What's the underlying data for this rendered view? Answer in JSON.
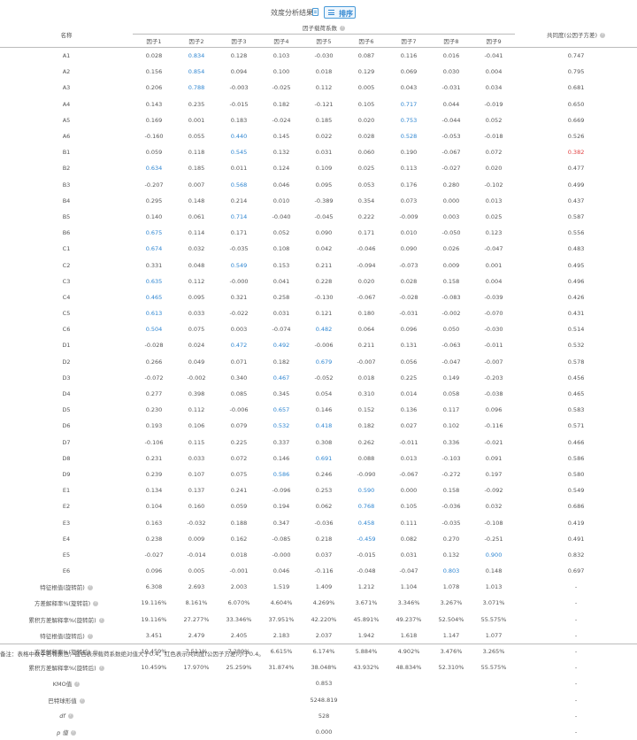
{
  "toolbar": {
    "title": "效度分析结果",
    "sort_label": "排序"
  },
  "table": {
    "name_header": "名称",
    "loading_header": "因子载荷系数",
    "communality_header": "共同度(公因子方差)",
    "factor_headers": [
      "因子1",
      "因子2",
      "因子3",
      "因子4",
      "因子5",
      "因子6",
      "因子7",
      "因子8",
      "因子9"
    ],
    "rows": [
      {
        "name": "A1",
        "vals": [
          "0.028",
          "0.834",
          "0.128",
          "0.103",
          "-0.030",
          "0.087",
          "0.116",
          "0.016",
          "-0.041"
        ],
        "hl": [
          1
        ],
        "comm": "0.747",
        "comm_red": false
      },
      {
        "name": "A2",
        "vals": [
          "0.156",
          "0.854",
          "0.094",
          "0.100",
          "0.018",
          "0.129",
          "0.069",
          "0.030",
          "0.004"
        ],
        "hl": [
          1
        ],
        "comm": "0.795",
        "comm_red": false
      },
      {
        "name": "A3",
        "vals": [
          "0.206",
          "0.788",
          "-0.003",
          "-0.025",
          "0.112",
          "0.005",
          "0.043",
          "-0.031",
          "0.034"
        ],
        "hl": [
          1
        ],
        "comm": "0.681",
        "comm_red": false
      },
      {
        "name": "A4",
        "vals": [
          "0.143",
          "0.235",
          "-0.015",
          "0.182",
          "-0.121",
          "0.105",
          "0.717",
          "0.044",
          "-0.019"
        ],
        "hl": [
          6
        ],
        "comm": "0.650",
        "comm_red": false
      },
      {
        "name": "A5",
        "vals": [
          "0.169",
          "0.001",
          "0.183",
          "-0.024",
          "0.185",
          "0.020",
          "0.753",
          "-0.044",
          "0.052"
        ],
        "hl": [
          6
        ],
        "comm": "0.669",
        "comm_red": false
      },
      {
        "name": "A6",
        "vals": [
          "-0.160",
          "0.055",
          "0.440",
          "0.145",
          "0.022",
          "0.028",
          "0.528",
          "-0.053",
          "-0.018"
        ],
        "hl": [
          2,
          6
        ],
        "comm": "0.526",
        "comm_red": false
      },
      {
        "name": "B1",
        "vals": [
          "0.059",
          "0.118",
          "0.545",
          "0.132",
          "0.031",
          "0.060",
          "0.190",
          "-0.067",
          "0.072"
        ],
        "hl": [
          2
        ],
        "comm": "0.382",
        "comm_red": true
      },
      {
        "name": "B2",
        "vals": [
          "0.634",
          "0.185",
          "0.011",
          "0.124",
          "0.109",
          "0.025",
          "0.113",
          "-0.027",
          "0.020"
        ],
        "hl": [
          0
        ],
        "comm": "0.477",
        "comm_red": false
      },
      {
        "name": "B3",
        "vals": [
          "-0.207",
          "0.007",
          "0.568",
          "0.046",
          "0.095",
          "0.053",
          "0.176",
          "0.280",
          "-0.102"
        ],
        "hl": [
          2
        ],
        "comm": "0.499",
        "comm_red": false
      },
      {
        "name": "B4",
        "vals": [
          "0.295",
          "0.148",
          "0.214",
          "0.010",
          "-0.389",
          "0.354",
          "0.073",
          "0.000",
          "0.013"
        ],
        "hl": [],
        "comm": "0.437",
        "comm_red": false
      },
      {
        "name": "B5",
        "vals": [
          "0.140",
          "0.061",
          "0.714",
          "-0.040",
          "-0.045",
          "0.222",
          "-0.009",
          "0.003",
          "0.025"
        ],
        "hl": [
          2
        ],
        "comm": "0.587",
        "comm_red": false
      },
      {
        "name": "B6",
        "vals": [
          "0.675",
          "0.114",
          "0.171",
          "0.052",
          "0.090",
          "0.171",
          "0.010",
          "-0.050",
          "0.123"
        ],
        "hl": [
          0
        ],
        "comm": "0.556",
        "comm_red": false
      },
      {
        "name": "C1",
        "vals": [
          "0.674",
          "0.032",
          "-0.035",
          "0.108",
          "0.042",
          "-0.046",
          "0.090",
          "0.026",
          "-0.047"
        ],
        "hl": [
          0
        ],
        "comm": "0.483",
        "comm_red": false
      },
      {
        "name": "C2",
        "vals": [
          "0.331",
          "0.048",
          "0.549",
          "0.153",
          "0.211",
          "-0.094",
          "-0.073",
          "0.009",
          "0.001"
        ],
        "hl": [
          2
        ],
        "comm": "0.495",
        "comm_red": false
      },
      {
        "name": "C3",
        "vals": [
          "0.635",
          "0.112",
          "-0.000",
          "0.041",
          "0.228",
          "0.020",
          "0.028",
          "0.158",
          "0.004"
        ],
        "hl": [
          0
        ],
        "comm": "0.496",
        "comm_red": false
      },
      {
        "name": "C4",
        "vals": [
          "0.465",
          "0.095",
          "0.321",
          "0.258",
          "-0.130",
          "-0.067",
          "-0.028",
          "-0.083",
          "-0.039"
        ],
        "hl": [
          0
        ],
        "comm": "0.426",
        "comm_red": false
      },
      {
        "name": "C5",
        "vals": [
          "0.613",
          "0.033",
          "-0.022",
          "0.031",
          "0.121",
          "0.180",
          "-0.031",
          "-0.002",
          "-0.070"
        ],
        "hl": [
          0
        ],
        "comm": "0.431",
        "comm_red": false
      },
      {
        "name": "C6",
        "vals": [
          "0.504",
          "0.075",
          "0.003",
          "-0.074",
          "0.482",
          "0.064",
          "0.096",
          "0.050",
          "-0.030"
        ],
        "hl": [
          0,
          4
        ],
        "comm": "0.514",
        "comm_red": false
      },
      {
        "name": "D1",
        "vals": [
          "-0.028",
          "0.024",
          "0.472",
          "0.492",
          "-0.006",
          "0.211",
          "0.131",
          "-0.063",
          "-0.011"
        ],
        "hl": [
          2,
          3
        ],
        "comm": "0.532",
        "comm_red": false
      },
      {
        "name": "D2",
        "vals": [
          "0.266",
          "0.049",
          "0.071",
          "0.182",
          "0.679",
          "-0.007",
          "0.056",
          "-0.047",
          "-0.007"
        ],
        "hl": [
          4
        ],
        "comm": "0.578",
        "comm_red": false
      },
      {
        "name": "D3",
        "vals": [
          "-0.072",
          "-0.002",
          "0.340",
          "0.467",
          "-0.052",
          "0.018",
          "0.225",
          "0.149",
          "-0.203"
        ],
        "hl": [
          3
        ],
        "comm": "0.456",
        "comm_red": false
      },
      {
        "name": "D4",
        "vals": [
          "0.277",
          "0.398",
          "0.085",
          "0.345",
          "0.054",
          "0.310",
          "0.014",
          "0.058",
          "-0.038"
        ],
        "hl": [],
        "comm": "0.465",
        "comm_red": false
      },
      {
        "name": "D5",
        "vals": [
          "0.230",
          "0.112",
          "-0.006",
          "0.657",
          "0.146",
          "0.152",
          "0.136",
          "0.117",
          "0.096"
        ],
        "hl": [
          3
        ],
        "comm": "0.583",
        "comm_red": false
      },
      {
        "name": "D6",
        "vals": [
          "0.193",
          "0.106",
          "0.079",
          "0.532",
          "0.418",
          "0.182",
          "0.027",
          "0.102",
          "-0.116"
        ],
        "hl": [
          3,
          4
        ],
        "comm": "0.571",
        "comm_red": false
      },
      {
        "name": "D7",
        "vals": [
          "-0.106",
          "0.115",
          "0.225",
          "0.337",
          "0.308",
          "0.262",
          "-0.011",
          "0.336",
          "-0.021"
        ],
        "hl": [],
        "comm": "0.466",
        "comm_red": false
      },
      {
        "name": "D8",
        "vals": [
          "0.231",
          "0.033",
          "0.072",
          "0.146",
          "0.691",
          "0.088",
          "0.013",
          "-0.103",
          "0.091"
        ],
        "hl": [
          4
        ],
        "comm": "0.586",
        "comm_red": false
      },
      {
        "name": "D9",
        "vals": [
          "0.239",
          "0.107",
          "0.075",
          "0.586",
          "0.246",
          "-0.090",
          "-0.067",
          "-0.272",
          "0.197"
        ],
        "hl": [
          3
        ],
        "comm": "0.580",
        "comm_red": false
      },
      {
        "name": "E1",
        "vals": [
          "0.134",
          "0.137",
          "0.241",
          "-0.096",
          "0.253",
          "0.590",
          "0.000",
          "0.158",
          "-0.092"
        ],
        "hl": [
          5
        ],
        "comm": "0.549",
        "comm_red": false
      },
      {
        "name": "E2",
        "vals": [
          "0.104",
          "0.160",
          "0.059",
          "0.194",
          "0.062",
          "0.768",
          "0.105",
          "-0.036",
          "0.032"
        ],
        "hl": [
          5
        ],
        "comm": "0.686",
        "comm_red": false
      },
      {
        "name": "E3",
        "vals": [
          "0.163",
          "-0.032",
          "0.188",
          "0.347",
          "-0.036",
          "0.458",
          "0.111",
          "-0.035",
          "-0.108"
        ],
        "hl": [
          5
        ],
        "comm": "0.419",
        "comm_red": false
      },
      {
        "name": "E4",
        "vals": [
          "0.238",
          "0.009",
          "0.162",
          "-0.085",
          "0.218",
          "-0.459",
          "0.082",
          "0.270",
          "-0.251"
        ],
        "hl": [
          5
        ],
        "comm": "0.491",
        "comm_red": false
      },
      {
        "name": "E5",
        "vals": [
          "-0.027",
          "-0.014",
          "0.018",
          "-0.000",
          "0.037",
          "-0.015",
          "0.031",
          "0.132",
          "0.900"
        ],
        "hl": [
          8
        ],
        "comm": "0.832",
        "comm_red": false
      },
      {
        "name": "E6",
        "vals": [
          "0.096",
          "0.005",
          "-0.001",
          "0.046",
          "-0.116",
          "-0.048",
          "-0.047",
          "0.803",
          "0.148"
        ],
        "hl": [
          7
        ],
        "comm": "0.697",
        "comm_red": false
      }
    ],
    "stats": [
      {
        "label": "特征根值(旋转前)",
        "vals": [
          "6.308",
          "2.693",
          "2.003",
          "1.519",
          "1.409",
          "1.212",
          "1.104",
          "1.078",
          "1.013"
        ],
        "last": "-"
      },
      {
        "label": "方差解释率%(旋转前)",
        "vals": [
          "19.116%",
          "8.161%",
          "6.070%",
          "4.604%",
          "4.269%",
          "3.671%",
          "3.346%",
          "3.267%",
          "3.071%"
        ],
        "last": "-"
      },
      {
        "label": "累积方差解释率%(旋转前)",
        "vals": [
          "19.116%",
          "27.277%",
          "33.346%",
          "37.951%",
          "42.220%",
          "45.891%",
          "49.237%",
          "52.504%",
          "55.575%"
        ],
        "last": "-"
      },
      {
        "label": "特征根值(旋转后)",
        "vals": [
          "3.451",
          "2.479",
          "2.405",
          "2.183",
          "2.037",
          "1.942",
          "1.618",
          "1.147",
          "1.077"
        ],
        "last": "-"
      },
      {
        "label": "方差解释率%(旋转后)",
        "vals": [
          "10.459%",
          "7.511%",
          "7.289%",
          "6.615%",
          "6.174%",
          "5.884%",
          "4.902%",
          "3.476%",
          "3.265%"
        ],
        "last": "-"
      },
      {
        "label": "累积方差解释率%(旋转后)",
        "vals": [
          "10.459%",
          "17.970%",
          "25.259%",
          "31.874%",
          "38.048%",
          "43.932%",
          "48.834%",
          "52.310%",
          "55.575%"
        ],
        "last": "-"
      }
    ],
    "tests": [
      {
        "label": "KMO值",
        "value": "0.853",
        "last": "-"
      },
      {
        "label": "巴特球形值",
        "value": "5248.819",
        "last": "-"
      },
      {
        "label": "df",
        "value": "528",
        "last": "-"
      },
      {
        "label": "p 值",
        "value": "0.000",
        "last": "-"
      }
    ],
    "help_glyph": "?"
  },
  "note": "备注：表格中数字若有颜色：蓝色表示载荷系数绝对值大于0.4，红色表示共同度(公因子方差)小于0.4。",
  "colors": {
    "highlight_blue": "#2f86d1",
    "highlight_red": "#e04040"
  }
}
